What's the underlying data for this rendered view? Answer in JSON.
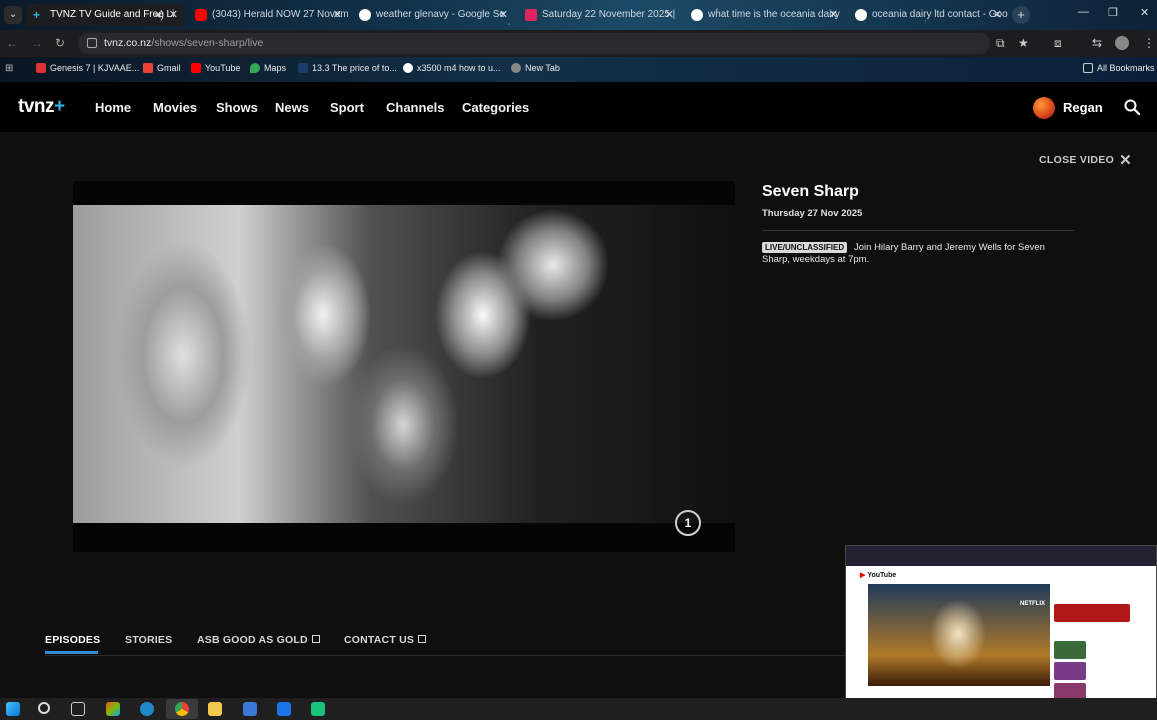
{
  "browser": {
    "tabs": [
      {
        "title": "TVNZ TV Guide and Free Li",
        "active": true,
        "icon": "tvnz-plus-icon"
      },
      {
        "title": "(3043) Herald NOW 27 Novem",
        "icon": "youtube-icon"
      },
      {
        "title": "weather glenavy - Google Se",
        "icon": "google-icon"
      },
      {
        "title": "Saturday 22 November 2025 |",
        "icon": "play-icon"
      },
      {
        "title": "what time is the oceania dairy",
        "icon": "google-icon"
      },
      {
        "title": "oceania dairy ltd contact - Goo",
        "icon": "google-icon"
      }
    ],
    "tab_close": "✕",
    "new_tab": "+",
    "url_host": "tvnz.co.nz",
    "url_path": "/shows/seven-sharp/live",
    "bookmarks": [
      {
        "label": "Genesis 7 | KJVAAE...",
        "color": "#d33"
      },
      {
        "label": "Gmail",
        "color": "#ea4335"
      },
      {
        "label": "YouTube",
        "color": "#ff0000"
      },
      {
        "label": "Maps",
        "color": "#34a853"
      },
      {
        "label": "13.3 The price of to...",
        "color": "#1a3d6b"
      },
      {
        "label": "x3500 m4 how to u...",
        "color": "#4285f4"
      },
      {
        "label": "New Tab",
        "color": "#888888"
      }
    ],
    "all_bookmarks": "All Bookmarks"
  },
  "site": {
    "logo": "tvnz",
    "logo_plus": "+",
    "nav": [
      "Home",
      "Movies",
      "Shows",
      "News",
      "Sport",
      "Channels",
      "Categories"
    ],
    "user": "Regan"
  },
  "video": {
    "close_label": "CLOSE VIDEO",
    "channel_bug": "1"
  },
  "show": {
    "title": "Seven Sharp",
    "date": "Thursday 27 Nov 2025",
    "badge": "LIVE/UNCLASSIFIED",
    "description": "Join Hilary Barry and Jeremy Wells for Seven Sharp, weekdays at 7pm."
  },
  "subtabs": [
    "EPISODES",
    "STORIES",
    "ASB GOOD AS GOLD",
    "CONTACT US"
  ],
  "pip": {
    "site": "YouTube",
    "badge": "NETFLIX"
  },
  "colors": {
    "accent": "#2e8bd6",
    "logo_plus": "#33b5e5",
    "background": "#0f0f10"
  }
}
